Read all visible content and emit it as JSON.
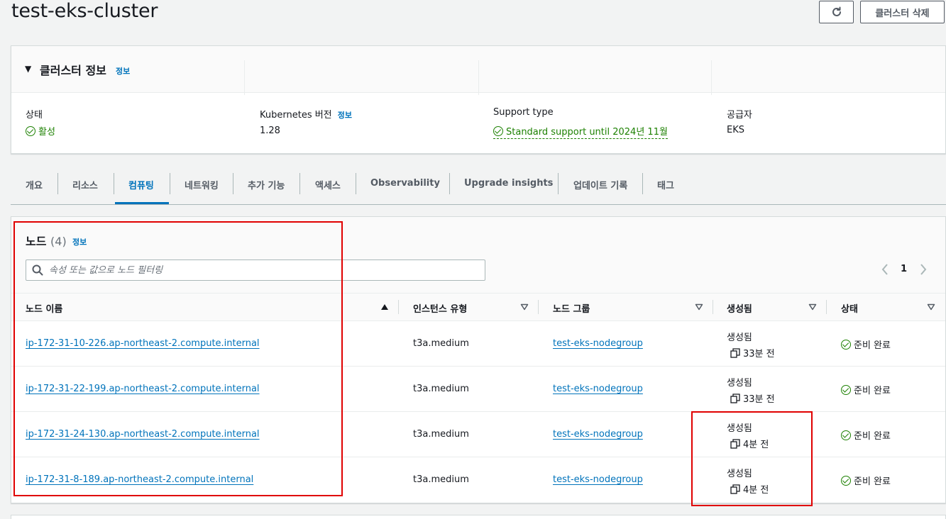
{
  "page": {
    "title": "test-eks-cluster",
    "delete_label": "클러스터 삭제"
  },
  "cluster_info": {
    "title": "클러스터 정보",
    "info_link": "정보",
    "status_label": "상태",
    "status_value": "활성",
    "k8s_label": "Kubernetes 버전",
    "k8s_info": "정보",
    "k8s_value": "1.28",
    "support_label": "Support type",
    "support_value": "Standard support until 2024년 11월",
    "provider_label": "공급자",
    "provider_value": "EKS"
  },
  "tabs": [
    "개요",
    "리소스",
    "컴퓨팅",
    "네트워킹",
    "추가 기능",
    "액세스",
    "Observability",
    "Upgrade insights",
    "업데이트 기록",
    "태그"
  ],
  "active_tab": "컴퓨팅",
  "nodes": {
    "title": "노드",
    "count": "(4)",
    "info_link": "정보",
    "search_placeholder": "속성 또는 값으로 노드 필터링",
    "page": "1",
    "columns": [
      "노드 이름",
      "인스턴스 유형",
      "노드 그룹",
      "생성됨",
      "상태"
    ],
    "rows": [
      {
        "name": "ip-172-31-10-226.ap-northeast-2.compute.internal",
        "instance_type": "t3a.medium",
        "node_group": "test-eks-nodegroup",
        "created_label": "생성됨",
        "created_ago": "33분 전",
        "status": "준비 완료"
      },
      {
        "name": "ip-172-31-22-199.ap-northeast-2.compute.internal",
        "instance_type": "t3a.medium",
        "node_group": "test-eks-nodegroup",
        "created_label": "생성됨",
        "created_ago": "33분 전",
        "status": "준비 완료"
      },
      {
        "name": "ip-172-31-24-130.ap-northeast-2.compute.internal",
        "instance_type": "t3a.medium",
        "node_group": "test-eks-nodegroup",
        "created_label": "생성됨",
        "created_ago": "4분 전",
        "status": "준비 완료"
      },
      {
        "name": "ip-172-31-8-189.ap-northeast-2.compute.internal",
        "instance_type": "t3a.medium",
        "node_group": "test-eks-nodegroup",
        "created_label": "생성됨",
        "created_ago": "4분 전",
        "status": "준비 완료"
      }
    ]
  },
  "colors": {
    "link": "#0073bb",
    "success": "#1d8102",
    "highlight": "#e00000"
  }
}
